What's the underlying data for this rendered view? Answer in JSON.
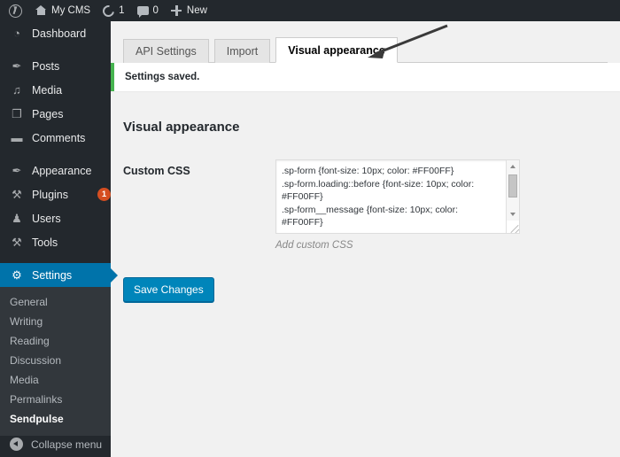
{
  "adminbar": {
    "logo_icon": "wordpress-logo-icon",
    "site_name": "My CMS",
    "home_icon": "home-icon",
    "updates_icon": "refresh-icon",
    "updates_count": "1",
    "comments_icon": "comment-icon",
    "comments_count": "0",
    "new_icon": "plus-icon",
    "new_label": "New"
  },
  "sidebar": {
    "items": [
      {
        "label": "Dashboard",
        "icon": "dashboard-icon",
        "glyph": "◔",
        "active": false,
        "badge": null
      },
      {
        "label": "Posts",
        "icon": "pin-icon",
        "glyph": "✒",
        "active": false,
        "badge": null
      },
      {
        "label": "Media",
        "icon": "media-icon",
        "glyph": "♫",
        "active": false,
        "badge": null
      },
      {
        "label": "Pages",
        "icon": "page-icon",
        "glyph": "❐",
        "active": false,
        "badge": null
      },
      {
        "label": "Comments",
        "icon": "comment-icon",
        "glyph": "▬",
        "active": false,
        "badge": null
      },
      {
        "label": "Appearance",
        "icon": "brush-icon",
        "glyph": "✒",
        "active": false,
        "badge": null
      },
      {
        "label": "Plugins",
        "icon": "plug-icon",
        "glyph": "⚒",
        "active": false,
        "badge": "1"
      },
      {
        "label": "Users",
        "icon": "user-icon",
        "glyph": "♟",
        "active": false,
        "badge": null
      },
      {
        "label": "Tools",
        "icon": "wrench-icon",
        "glyph": "⚒",
        "active": false,
        "badge": null
      },
      {
        "label": "Settings",
        "icon": "settings-icon",
        "glyph": "⚙",
        "active": true,
        "badge": null
      }
    ],
    "submenu": [
      {
        "label": "General",
        "current": false
      },
      {
        "label": "Writing",
        "current": false
      },
      {
        "label": "Reading",
        "current": false
      },
      {
        "label": "Discussion",
        "current": false
      },
      {
        "label": "Media",
        "current": false
      },
      {
        "label": "Permalinks",
        "current": false
      },
      {
        "label": "Sendpulse",
        "current": true
      }
    ],
    "collapse_label": "Collapse menu",
    "collapse_icon": "chevron-left-circle-icon"
  },
  "tabs": [
    {
      "label": "API Settings",
      "active": false
    },
    {
      "label": "Import",
      "active": false
    },
    {
      "label": "Visual appearance",
      "active": true
    }
  ],
  "notice": {
    "text": "Settings saved.",
    "accent_color": "#46b450"
  },
  "main": {
    "page_title": "Visual appearance",
    "custom_css_label": "Custom CSS",
    "custom_css_value": ".sp-form {font-size: 10px; color: #FF00FF}\n.sp-form.loading::before {font-size: 10px; color: #FF00FF}\n.sp-form__message {font-size: 10px; color: #FF00FF}",
    "custom_css_placeholder": "Add custom CSS",
    "help_text": "Add custom CSS",
    "save_label": "Save Changes"
  },
  "annotation": {
    "arrow_icon": "left-arrow-annotation",
    "color": "#3a3a3a"
  },
  "colors": {
    "sidebar_bg": "#23282d",
    "submenu_bg": "#32373c",
    "active_blue": "#0073aa",
    "button_blue": "#0085ba",
    "badge_orange": "#d54e21",
    "notice_green": "#46b450"
  }
}
